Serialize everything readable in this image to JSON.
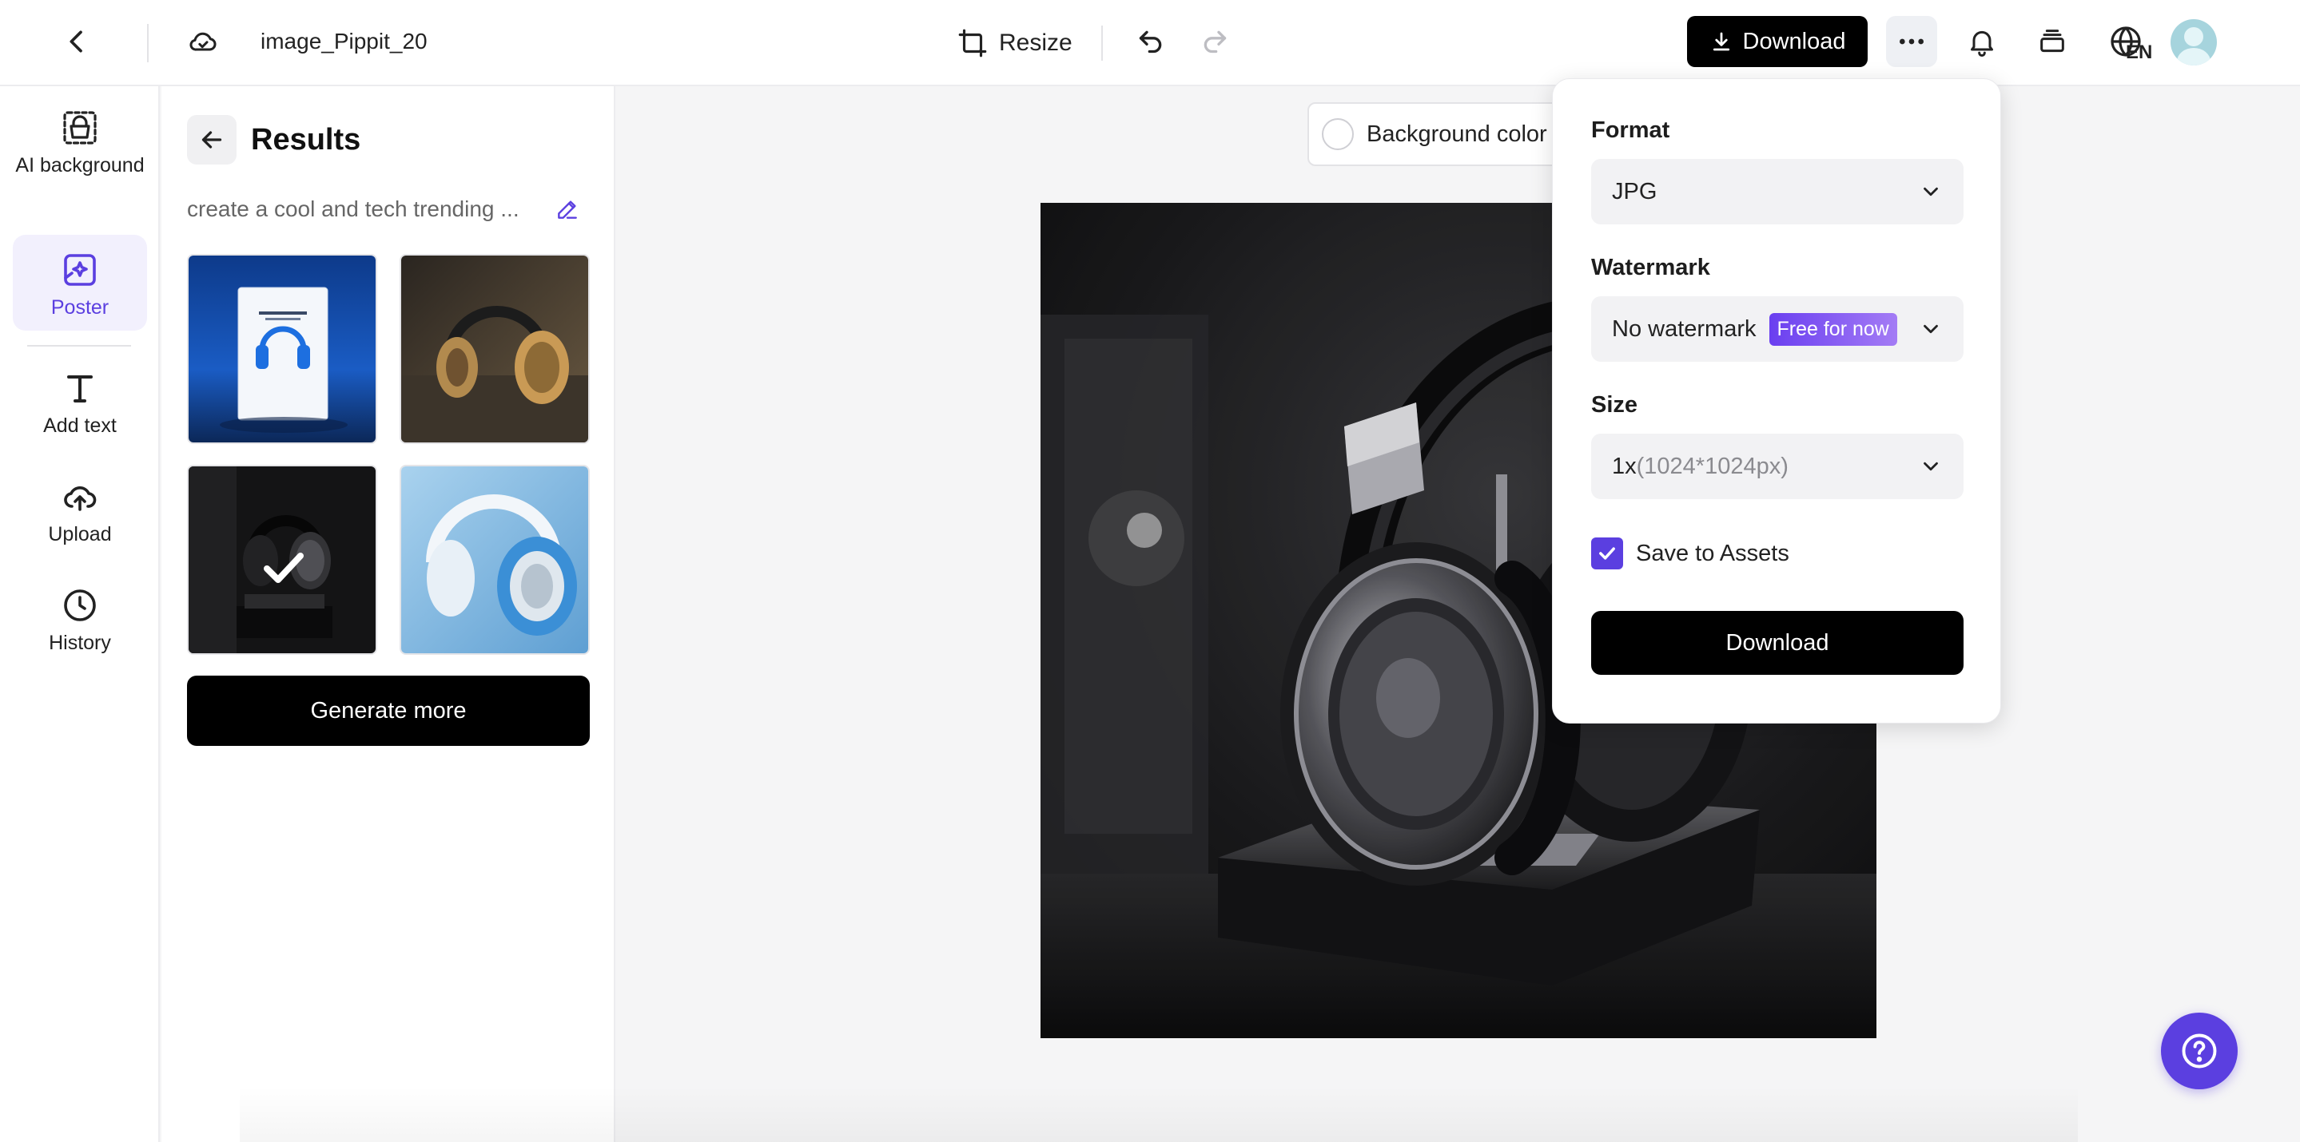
{
  "header": {
    "filename": "image_Pippit_20",
    "resize_label": "Resize",
    "download_label": "Download",
    "language": "EN"
  },
  "leftnav": {
    "items": [
      {
        "label": "AI background",
        "icon": "bag-dashed-icon"
      },
      {
        "label": "Poster",
        "icon": "poster-sparkle-icon"
      },
      {
        "label": "Add text",
        "icon": "text-t-icon"
      },
      {
        "label": "Upload",
        "icon": "cloud-upload-icon"
      },
      {
        "label": "History",
        "icon": "clock-icon"
      }
    ],
    "active": "Poster"
  },
  "results": {
    "title": "Results",
    "prompt": "create a cool and tech trending ...",
    "thumbnails": [
      {
        "desc": "blue headphones box",
        "selected": false
      },
      {
        "desc": "gold headphones",
        "selected": false
      },
      {
        "desc": "black headphones on stand",
        "selected": true
      },
      {
        "desc": "white and blue headphones",
        "selected": false
      }
    ],
    "generate_more_label": "Generate more"
  },
  "canvas": {
    "background_color_label": "Background color"
  },
  "download_popover": {
    "format_label": "Format",
    "format_value": "JPG",
    "watermark_label": "Watermark",
    "watermark_value": "No watermark",
    "watermark_badge": "Free for now",
    "size_label": "Size",
    "size_value": "1x",
    "size_detail": "(1024*1024px)",
    "save_assets_label": "Save to Assets",
    "save_assets_checked": true,
    "download_label": "Download"
  },
  "colors": {
    "accent": "#5b3fe0",
    "primary_button": "#000000"
  }
}
